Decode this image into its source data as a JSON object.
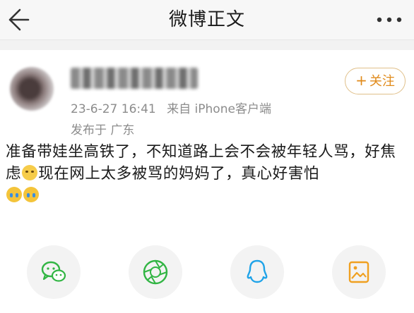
{
  "header": {
    "title": "微博正文",
    "back_icon": "back-arrow-icon",
    "more_icon": "more-dots-icon"
  },
  "post": {
    "author": {
      "name": "(blurred)"
    },
    "follow_label": "关注",
    "date": "23-6-27 16:41",
    "source": "来自 iPhone客户端",
    "location": "发布于 广东",
    "text_part1": "准备带娃坐高铁了，不知道路上会不会被年轻人骂，好焦虑",
    "text_part2": "现在网上太多被骂的妈妈了，真心好害怕"
  },
  "share_icons": [
    "wechat-icon",
    "moments-icon",
    "qq-icon",
    "save-image-icon"
  ],
  "colors": {
    "wechat": "#31b543",
    "moments": "#31b543",
    "qq": "#1fa3e8",
    "save": "#f0a020",
    "follow": "#e08a1a"
  }
}
